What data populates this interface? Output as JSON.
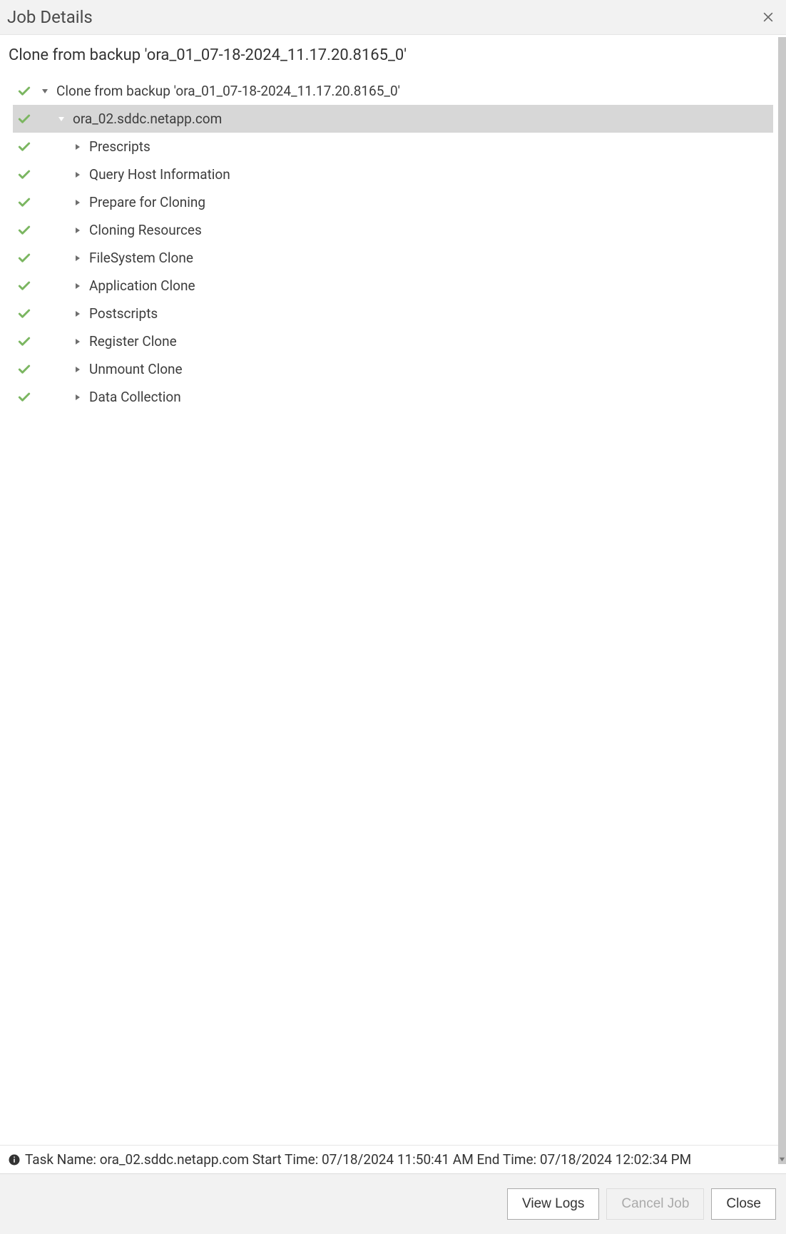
{
  "dialog": {
    "title": "Job Details",
    "subtitle": "Clone from backup 'ora_01_07-18-2024_11.17.20.8165_0'"
  },
  "tree": {
    "rows": [
      {
        "label": "Clone from backup 'ora_01_07-18-2024_11.17.20.8165_0'",
        "indent": 0,
        "expanded": true,
        "selected": false,
        "expandColor": "dark"
      },
      {
        "label": "ora_02.sddc.netapp.com",
        "indent": 1,
        "expanded": true,
        "selected": true,
        "expandColor": "light"
      },
      {
        "label": "Prescripts",
        "indent": 2,
        "expanded": false,
        "selected": false,
        "expandColor": "dark"
      },
      {
        "label": "Query Host Information",
        "indent": 2,
        "expanded": false,
        "selected": false,
        "expandColor": "dark"
      },
      {
        "label": "Prepare for Cloning",
        "indent": 2,
        "expanded": false,
        "selected": false,
        "expandColor": "dark"
      },
      {
        "label": "Cloning Resources",
        "indent": 2,
        "expanded": false,
        "selected": false,
        "expandColor": "dark"
      },
      {
        "label": "FileSystem Clone",
        "indent": 2,
        "expanded": false,
        "selected": false,
        "expandColor": "dark"
      },
      {
        "label": "Application Clone",
        "indent": 2,
        "expanded": false,
        "selected": false,
        "expandColor": "dark"
      },
      {
        "label": "Postscripts",
        "indent": 2,
        "expanded": false,
        "selected": false,
        "expandColor": "dark"
      },
      {
        "label": "Register Clone",
        "indent": 2,
        "expanded": false,
        "selected": false,
        "expandColor": "dark"
      },
      {
        "label": "Unmount Clone",
        "indent": 2,
        "expanded": false,
        "selected": false,
        "expandColor": "dark"
      },
      {
        "label": "Data Collection",
        "indent": 2,
        "expanded": false,
        "selected": false,
        "expandColor": "dark"
      }
    ]
  },
  "statusbar": {
    "text": "Task Name: ora_02.sddc.netapp.com Start Time: 07/18/2024 11:50:41 AM End Time: 07/18/2024 12:02:34 PM"
  },
  "footer": {
    "viewLogs": "View Logs",
    "cancelJob": "Cancel Job",
    "close": "Close"
  }
}
